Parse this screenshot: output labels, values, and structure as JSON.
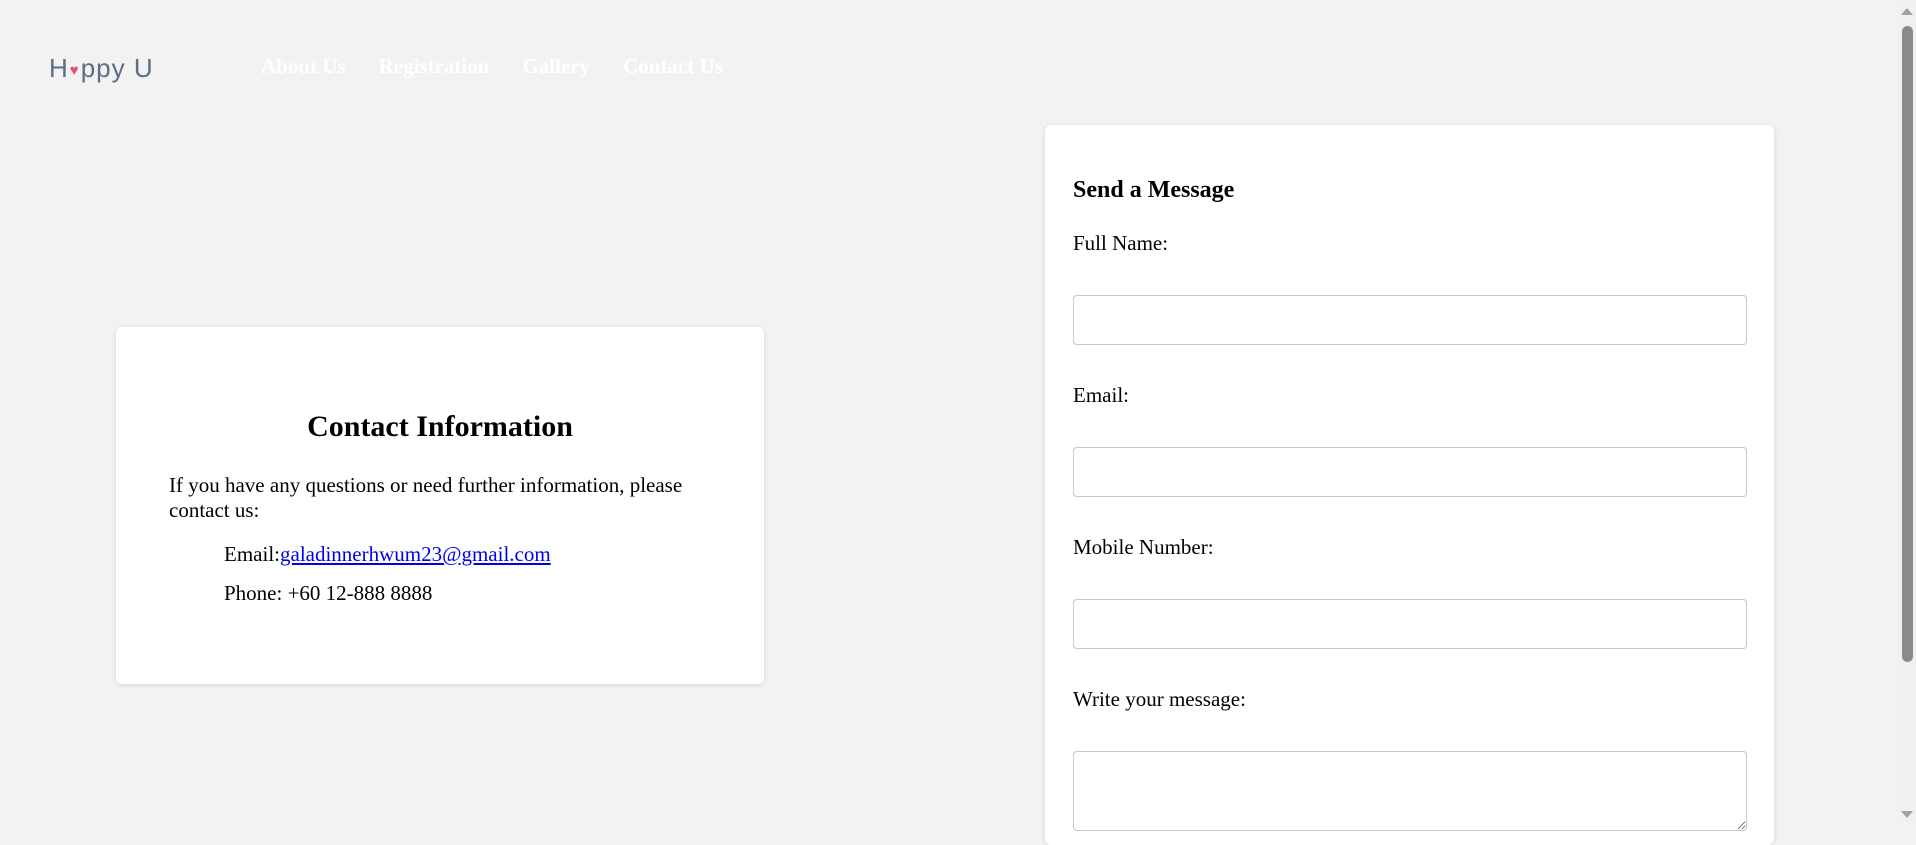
{
  "header": {
    "logo": {
      "prefix": "H",
      "heart": "♥",
      "suffix": "ppy U"
    },
    "nav": [
      "About Us",
      "Registration",
      "Gallery",
      "Contact Us"
    ]
  },
  "contact_info": {
    "title": "Contact Information",
    "description": "If you have any questions or need further information, please contact us:",
    "email_label": "Email:",
    "email_value": "galadinnerhwum23@gmail.com",
    "phone_text": "Phone: +60 12-888 8888"
  },
  "message_form": {
    "title": "Send a Message",
    "labels": {
      "full_name": "Full Name:",
      "email": "Email:",
      "mobile": "Mobile Number:",
      "message": "Write your message:"
    },
    "values": {
      "full_name": "",
      "email": "",
      "mobile": "",
      "message": ""
    }
  }
}
